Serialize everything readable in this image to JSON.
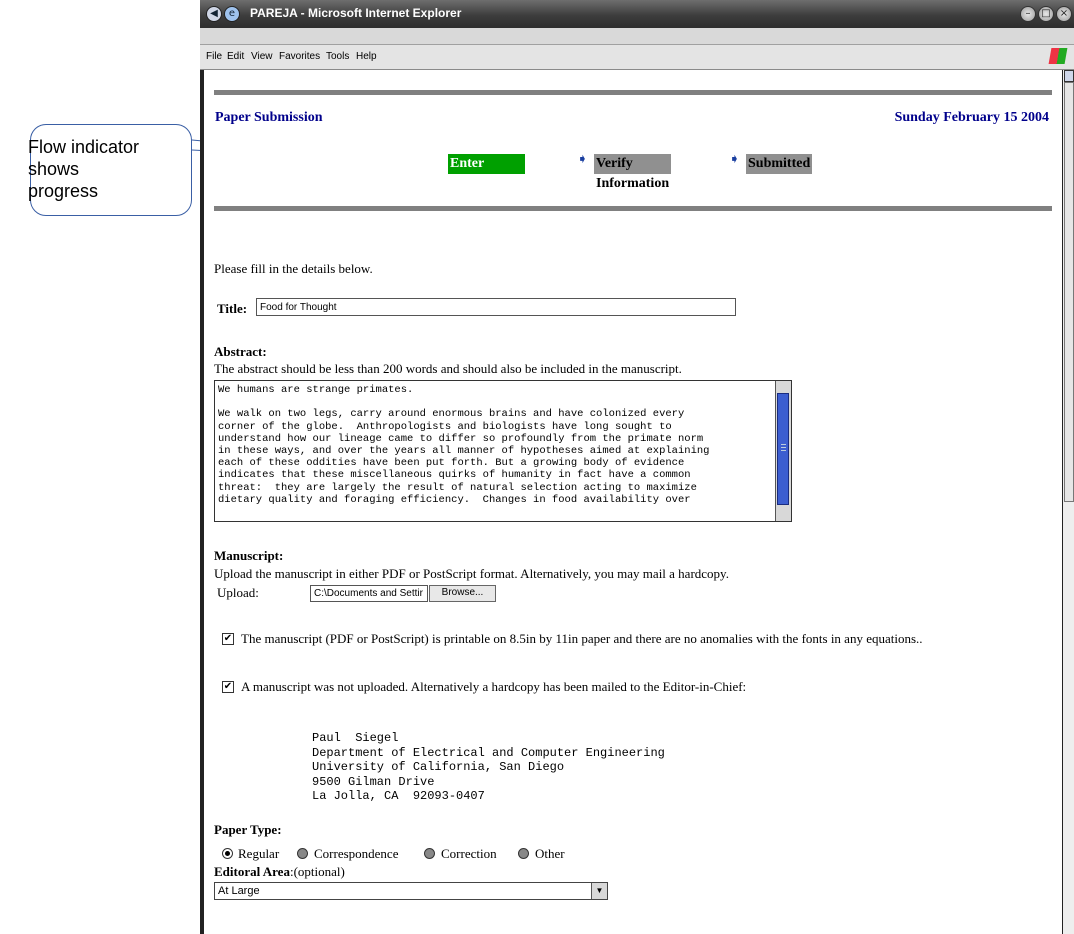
{
  "callout": {
    "text": "Flow indicator\nshows\nprogress"
  },
  "window": {
    "title": "PAREJA - Microsoft Internet Explorer",
    "menu": [
      "File",
      "Edit",
      "View",
      "Favorites",
      "Tools",
      "Help"
    ]
  },
  "page": {
    "header_left": "Paper Submission",
    "header_right": "Sunday February 15 2004",
    "flow": {
      "steps": [
        "Enter Information",
        "Verify Information",
        "Submitted"
      ],
      "active_step": "Enter Information"
    },
    "intro": "Please fill in the details below.",
    "title_label": "Title:",
    "title_value": "Food for Thought",
    "abstract_label": "Abstract:",
    "abstract_help": "The abstract should be less than 200 words and should also be included in the manuscript.",
    "abstract_text": "We humans are strange primates.\n\nWe walk on two legs, carry around enormous brains and have colonized every\ncorner of the globe.  Anthropologists and biologists have long sought to\nunderstand how our lineage came to differ so profoundly from the primate norm\nin these ways, and over the years all manner of hypotheses aimed at explaining\neach of these oddities have been put forth. But a growing body of evidence\nindicates that these miscellaneous quirks of humanity in fact have a common\nthreat:  they are largely the result of natural selection acting to maximize\ndietary quality and foraging efficiency.  Changes in food availability over",
    "manuscript_label": "Manuscript:",
    "manuscript_help": "Upload the manuscript in either PDF or PostScript format. Alternatively, you may mail a hardcopy.",
    "upload_label": "Upload:",
    "upload_value": "C:\\Documents and Settir",
    "browse_label": "Browse...",
    "check1_label": "The manuscript (PDF or PostScript) is printable on 8.5in by 11in paper and there are no anomalies with the fonts in any equations..",
    "check1_checked": true,
    "check2_label": "A manuscript was not uploaded. Alternatively a hardcopy has been mailed to the Editor-in-Chief:",
    "check2_checked": true,
    "address": "Paul  Siegel\nDepartment of Electrical and Computer Engineering\nUniversity of California, San Diego\n9500 Gilman Drive\nLa Jolla, CA  92093-0407",
    "paper_type_label": "Paper Type:",
    "paper_types": [
      "Regular",
      "Correspondence",
      "Correction",
      "Other"
    ],
    "paper_type_selected": "Regular",
    "area_label": "Editoral Area",
    "area_optional": ":(optional)",
    "area_value": "At Large"
  },
  "colors": {
    "heading_blue": "#00008b",
    "active_step": "#00a000",
    "inactive_step": "#909090",
    "rule_gray": "#808080"
  }
}
